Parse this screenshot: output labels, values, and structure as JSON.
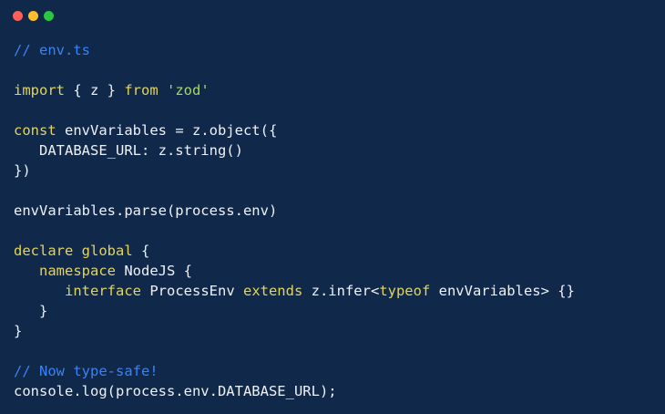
{
  "window": {
    "controls": [
      {
        "name": "close",
        "color": "#ff5f57"
      },
      {
        "name": "minimize",
        "color": "#febc2e"
      },
      {
        "name": "maximize",
        "color": "#28c840"
      }
    ]
  },
  "colors": {
    "background": "#10284a",
    "comment": "#3b82f6",
    "keyword": "#e3d45a",
    "string": "#a6d86a",
    "text": "#eef2f7"
  },
  "code": {
    "lines": [
      [
        {
          "t": "comment",
          "v": "// env.ts"
        }
      ],
      [],
      [
        {
          "t": "keyword",
          "v": "import"
        },
        {
          "t": "plain",
          "v": " { z } "
        },
        {
          "t": "keyword",
          "v": "from"
        },
        {
          "t": "plain",
          "v": " "
        },
        {
          "t": "string",
          "v": "'zod'"
        }
      ],
      [],
      [
        {
          "t": "keyword",
          "v": "const"
        },
        {
          "t": "plain",
          "v": " envVariables = z.object({"
        }
      ],
      [
        {
          "t": "plain",
          "v": "   DATABASE_URL: z.string()"
        }
      ],
      [
        {
          "t": "plain",
          "v": "})"
        }
      ],
      [],
      [
        {
          "t": "plain",
          "v": "envVariables.parse(process.env)"
        }
      ],
      [],
      [
        {
          "t": "keyword",
          "v": "declare"
        },
        {
          "t": "plain",
          "v": " "
        },
        {
          "t": "keyword",
          "v": "global"
        },
        {
          "t": "plain",
          "v": " {"
        }
      ],
      [
        {
          "t": "plain",
          "v": "   "
        },
        {
          "t": "keyword",
          "v": "namespace"
        },
        {
          "t": "plain",
          "v": " NodeJS {"
        }
      ],
      [
        {
          "t": "plain",
          "v": "      "
        },
        {
          "t": "keyword",
          "v": "interface"
        },
        {
          "t": "plain",
          "v": " ProcessEnv "
        },
        {
          "t": "keyword",
          "v": "extends"
        },
        {
          "t": "plain",
          "v": " z.infer<"
        },
        {
          "t": "keyword",
          "v": "typeof"
        },
        {
          "t": "plain",
          "v": " envVariables> {}"
        }
      ],
      [
        {
          "t": "plain",
          "v": "   }"
        }
      ],
      [
        {
          "t": "plain",
          "v": "}"
        }
      ],
      [],
      [
        {
          "t": "comment",
          "v": "// Now type-safe!"
        }
      ],
      [
        {
          "t": "plain",
          "v": "console.log(process.env.DATABASE_URL);"
        }
      ]
    ]
  }
}
